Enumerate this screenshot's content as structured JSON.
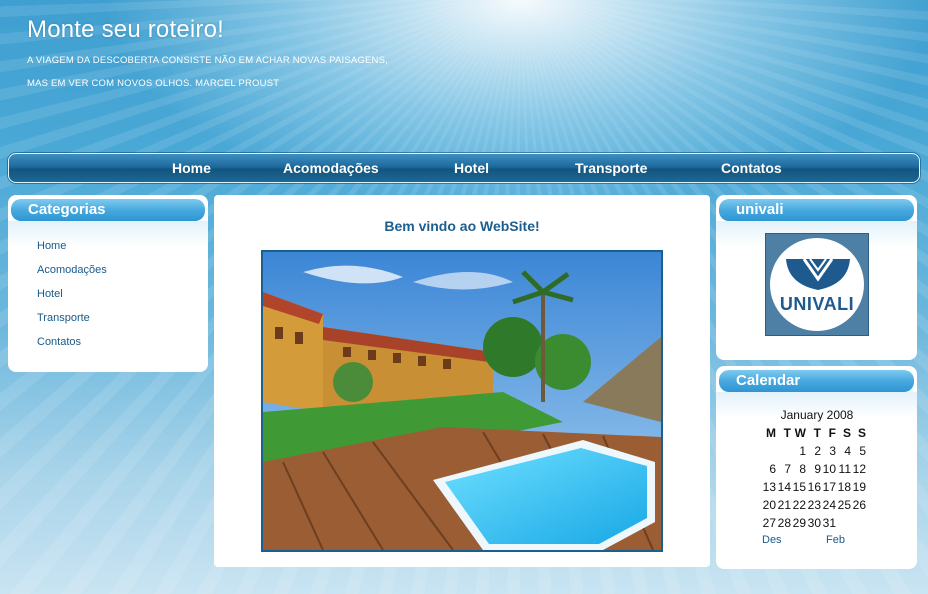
{
  "header": {
    "title": "Monte seu roteiro!",
    "tagline_1": "A VIAGEM DA DESCOBERTA CONSISTE NÃO EM ACHAR NOVAS PAISAGENS,",
    "tagline_2": "MAS EM VER COM NOVOS OLHOS. MARCEL PROUST"
  },
  "nav": [
    "Home",
    "Acomodações",
    "Hotel",
    "Transporte",
    "Contatos"
  ],
  "categories": {
    "title": "Categorias",
    "items": [
      "Home",
      "Acomodações",
      "Hotel",
      "Transporte",
      "Contatos"
    ]
  },
  "main": {
    "welcome": "Bem vindo ao WebSite!"
  },
  "univali": {
    "title": "univali",
    "logo_text": "UNIVALI"
  },
  "calendar": {
    "title": "Calendar",
    "month": "January 2008",
    "days": [
      "M",
      "T",
      "W",
      "T",
      "F",
      "S",
      "S"
    ],
    "weeks": [
      [
        "",
        "",
        "1",
        "2",
        "3",
        "4",
        "5"
      ],
      [
        "6",
        "7",
        "8",
        "9",
        "10",
        "11",
        "12"
      ],
      [
        "13",
        "14",
        "15",
        "16",
        "17",
        "18",
        "19"
      ],
      [
        "20",
        "21",
        "22",
        "23",
        "24",
        "25",
        "26"
      ],
      [
        "27",
        "28",
        "29",
        "30",
        "31",
        "",
        ""
      ]
    ],
    "prev": "Des",
    "next": "Feb"
  },
  "colors": {
    "accent": "#1c5f8e",
    "panel_header": "#48a9df",
    "nav_bar": "#1f6a9d"
  }
}
